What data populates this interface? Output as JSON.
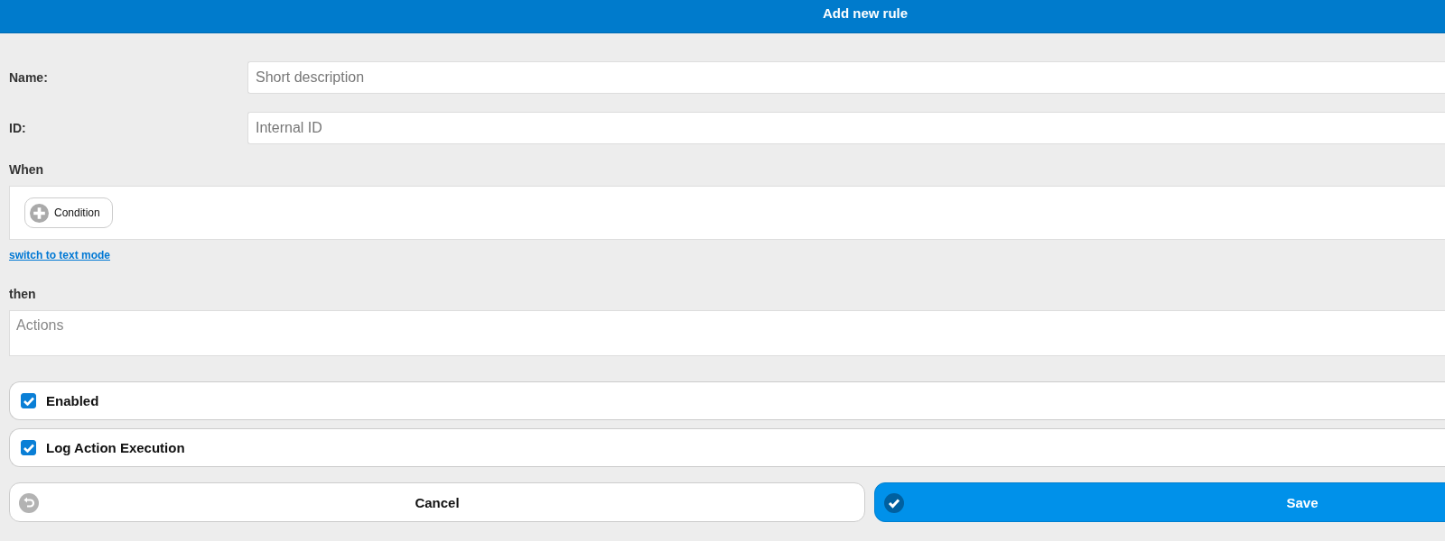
{
  "header": {
    "title": "Add new rule"
  },
  "fields": [
    {
      "label": "Name:",
      "placeholder": "Short description"
    },
    {
      "label": "ID:",
      "placeholder": "Internal ID"
    }
  ],
  "when": {
    "label": "When",
    "add_button": "Condition",
    "link": "switch to text mode"
  },
  "then": {
    "label": "then",
    "placeholder": "Actions"
  },
  "options": [
    {
      "label": "Enabled",
      "checked": true
    },
    {
      "label": "Log Action Execution",
      "checked": true
    }
  ],
  "buttons": [
    {
      "kind": "cancel",
      "label": "Cancel"
    },
    {
      "kind": "save",
      "label": "Save"
    }
  ]
}
